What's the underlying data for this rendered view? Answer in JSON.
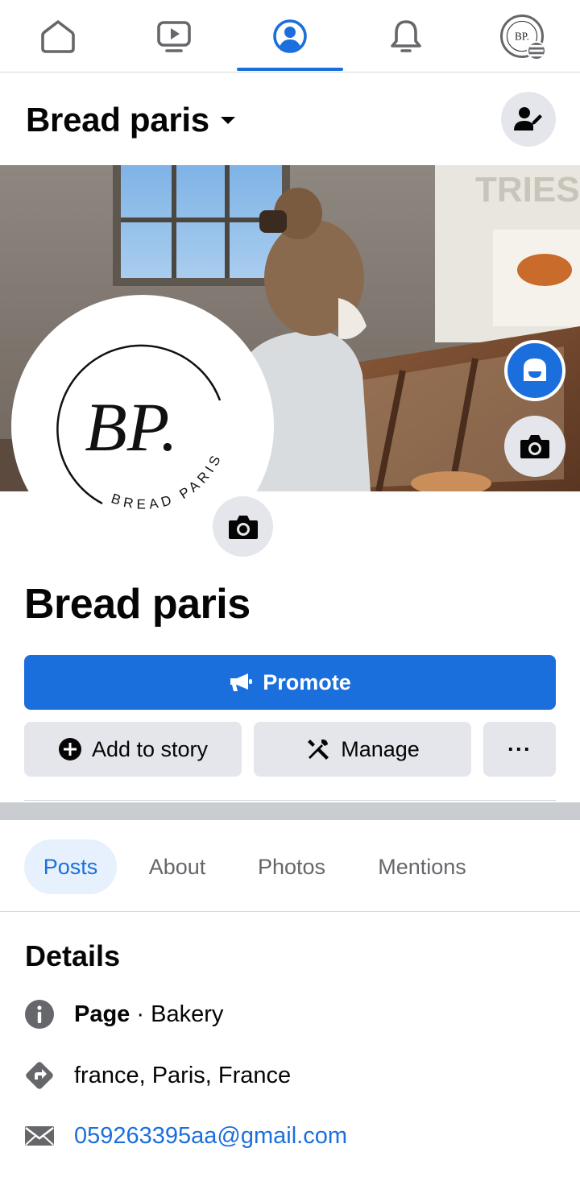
{
  "nav": {
    "tabs": [
      {
        "name": "home",
        "icon": "home-icon"
      },
      {
        "name": "watch",
        "icon": "video-icon"
      },
      {
        "name": "profile",
        "icon": "profile-icon",
        "active": true
      },
      {
        "name": "notifications",
        "icon": "bell-icon"
      },
      {
        "name": "menu",
        "icon": "avatar-menu-icon"
      }
    ],
    "avatar_initials": "BP."
  },
  "header": {
    "page_name": "Bread paris",
    "switch_icon": "person-edit-icon"
  },
  "profile": {
    "logo_initials": "BP.",
    "logo_caption": "BREAD PARIS",
    "display_name": "Bread paris"
  },
  "cover": {
    "sign_text": "TRIES BOX"
  },
  "actions": {
    "promote_label": "Promote",
    "add_story_label": "Add to story",
    "manage_label": "Manage",
    "more_label": "···"
  },
  "tabs": [
    {
      "label": "Posts",
      "active": true
    },
    {
      "label": "About",
      "active": false
    },
    {
      "label": "Photos",
      "active": false
    },
    {
      "label": "Mentions",
      "active": false
    }
  ],
  "details": {
    "title": "Details",
    "category_label": "Page",
    "category_value": " · Bakery",
    "location": "france, Paris, France",
    "email": "059263395aa@gmail.com"
  },
  "colors": {
    "accent": "#1b6fdc",
    "button_gray": "#e4e6eb",
    "text_secondary": "#65676b"
  }
}
